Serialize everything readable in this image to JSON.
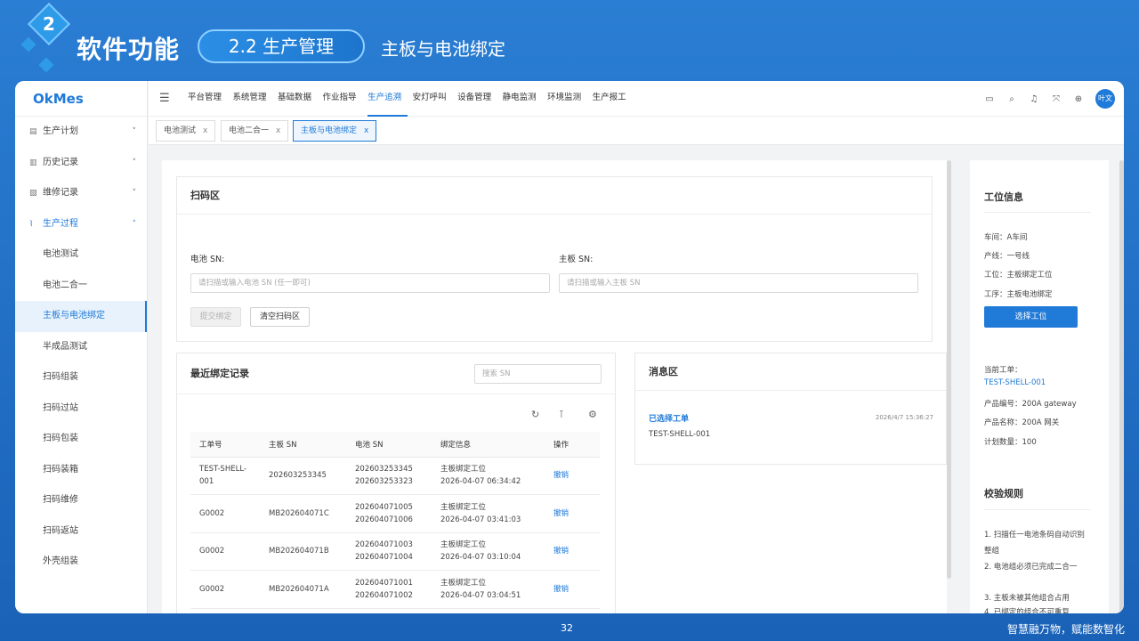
{
  "slide": {
    "section_number": "2",
    "title": "软件功能",
    "pill": "2.2 生产管理",
    "subtitle": "主板与电池绑定",
    "page_number": "32",
    "slogan": "智慧融万物，赋能数智化"
  },
  "app": {
    "logo": "OkMes",
    "sidebar": [
      {
        "label": "生产计划",
        "icon": "calendar-icon",
        "chevron": "˅"
      },
      {
        "label": "历史记录",
        "icon": "history-icon",
        "chevron": "˅"
      },
      {
        "label": "维修记录",
        "icon": "repair-icon",
        "chevron": "˅"
      },
      {
        "label": "生产过程",
        "icon": "process-icon",
        "chevron": "˄"
      }
    ],
    "submenu": [
      "电池测试",
      "电池二合一",
      "主板与电池绑定",
      "半成品测试",
      "扫码组装",
      "扫码过站",
      "扫码包装",
      "扫码装箱",
      "扫码维修",
      "扫码返站",
      "外壳组装"
    ],
    "topnav": [
      "平台管理",
      "系统管理",
      "基础数据",
      "作业指导",
      "生产追溯",
      "安灯呼叫",
      "设备管理",
      "静电监测",
      "环境监测",
      "生产报工"
    ],
    "avatar": "叶文",
    "tabs": [
      "电池测试",
      "电池二合一",
      "主板与电池绑定"
    ],
    "tab_close": "x"
  },
  "scan": {
    "title": "扫码区",
    "battery_label": "电池 SN:",
    "battery_placeholder": "请扫描或输入电池 SN (任一即可)",
    "board_label": "主板 SN:",
    "board_placeholder": "请扫描或输入主板 SN",
    "submit": "提交绑定",
    "clear": "清空扫码区"
  },
  "records": {
    "title": "最近绑定记录",
    "search_placeholder": "搜索 SN",
    "columns": [
      "工单号",
      "主板 SN",
      "电池 SN",
      "绑定信息",
      "操作"
    ],
    "rows": [
      {
        "order": "TEST-SHELL-001",
        "board": "202603253345",
        "battery1": "202603253345",
        "battery2": "202603253323",
        "station": "主板绑定工位",
        "time": "2026-04-07 06:34:42",
        "action": "撤销"
      },
      {
        "order": "G0002",
        "board": "MB202604071C",
        "battery1": "202604071005",
        "battery2": "202604071006",
        "station": "主板绑定工位",
        "time": "2026-04-07 03:41:03",
        "action": "撤销"
      },
      {
        "order": "G0002",
        "board": "MB202604071B",
        "battery1": "202604071003",
        "battery2": "202604071004",
        "station": "主板绑定工位",
        "time": "2026-04-07 03:10:04",
        "action": "撤销"
      },
      {
        "order": "G0002",
        "board": "MB202604071A",
        "battery1": "202604071001",
        "battery2": "202604071002",
        "station": "主板绑定工位",
        "time": "2026-04-07 03:04:51",
        "action": "撤销"
      }
    ]
  },
  "messages": {
    "title": "消息区",
    "items": [
      {
        "title": "已选择工单",
        "time": "2026/4/7 15:36:27",
        "body": "TEST-SHELL-001"
      }
    ]
  },
  "workstation": {
    "title": "工位信息",
    "workshop": "车间：A车间",
    "line": "产线：一号线",
    "station": "工位：主板绑定工位",
    "process": "工序：主板电池绑定",
    "select_button": "选择工位",
    "current_order_label": "当前工单：",
    "current_order": "TEST-SHELL-001",
    "product_code": "产品编号：200A gateway",
    "product_name": "产品名称：200A 网关",
    "plan_qty": "计划数量：100"
  },
  "rules": {
    "title": "校验规则",
    "items": [
      "1. 扫描任一电池条码自动识别整组",
      "2. 电池组必须已完成二合一",
      "3. 主板未被其他组合占用",
      "4. 已绑定的组合不可重复"
    ]
  },
  "colors": {
    "accent": "#1f7ad8",
    "slide_bg": "#2a7ed3"
  }
}
